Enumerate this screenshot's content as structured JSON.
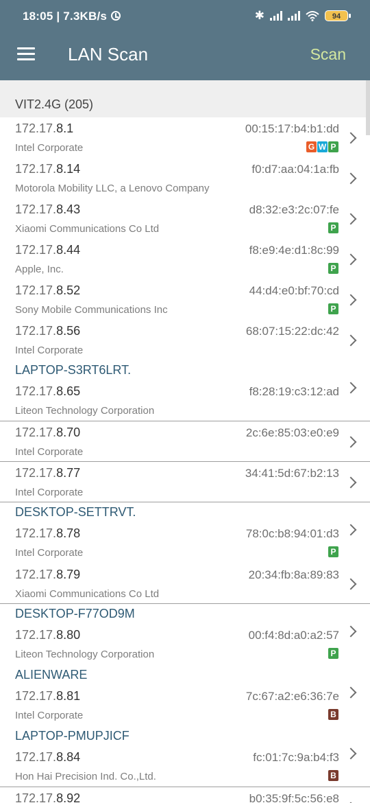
{
  "status_bar": {
    "time_speed": "18:05 | 7.3KB/s",
    "battery": "94"
  },
  "app_bar": {
    "title": "LAN Scan",
    "scan_label": "Scan"
  },
  "network": {
    "name": "VIT2.4G (205)"
  },
  "devices": [
    {
      "ip_prefix": "172.17.",
      "ip_suffix": "8.1",
      "mac": "00:15:17:b4:b1:dd",
      "vendor": "Intel Corporate",
      "badges": [
        "G",
        "W",
        "P"
      ]
    },
    {
      "ip_prefix": "172.17.",
      "ip_suffix": "8.14",
      "mac": "f0:d7:aa:04:1a:fb",
      "vendor": "Motorola Mobility LLC, a Lenovo Company",
      "badges": []
    },
    {
      "ip_prefix": "172.17.",
      "ip_suffix": "8.43",
      "mac": "d8:32:e3:2c:07:fe",
      "vendor": "Xiaomi Communications Co Ltd",
      "badges": [
        "P"
      ]
    },
    {
      "ip_prefix": "172.17.",
      "ip_suffix": "8.44",
      "mac": "f8:e9:4e:d1:8c:99",
      "vendor": "Apple, Inc.",
      "badges": [
        "P"
      ]
    },
    {
      "ip_prefix": "172.17.",
      "ip_suffix": "8.52",
      "mac": "44:d4:e0:bf:70:cd",
      "vendor": "Sony Mobile Communications Inc",
      "badges": [
        "P"
      ]
    },
    {
      "ip_prefix": "172.17.",
      "ip_suffix": "8.56",
      "mac": "68:07:15:22:dc:42",
      "vendor": "Intel Corporate",
      "badges": []
    },
    {
      "hostname": "LAPTOP-S3RT6LRT.",
      "ip_prefix": "172.17.",
      "ip_suffix": "8.65",
      "mac": "f8:28:19:c3:12:ad",
      "vendor": "Liteon Technology Corporation",
      "badges": []
    },
    {
      "ip_prefix": "172.17.",
      "ip_suffix": "8.70",
      "mac": "2c:6e:85:03:e0:e9",
      "vendor": "Intel Corporate",
      "badges": []
    },
    {
      "ip_prefix": "172.17.",
      "ip_suffix": "8.77",
      "mac": "34:41:5d:67:b2:13",
      "vendor": "Intel Corporate",
      "badges": []
    },
    {
      "hostname": "DESKTOP-SETTRVT.",
      "ip_prefix": "172.17.",
      "ip_suffix": "8.78",
      "mac": "78:0c:b8:94:01:d3",
      "vendor": "Intel Corporate",
      "badges": [
        "P"
      ]
    },
    {
      "ip_prefix": "172.17.",
      "ip_suffix": "8.79",
      "mac": "20:34:fb:8a:89:83",
      "vendor": "Xiaomi Communications Co Ltd",
      "badges": []
    },
    {
      "hostname": "DESKTOP-F77OD9M",
      "ip_prefix": "172.17.",
      "ip_suffix": "8.80",
      "mac": "00:f4:8d:a0:a2:57",
      "vendor": "Liteon Technology Corporation",
      "badges": [
        "P"
      ]
    },
    {
      "hostname": "ALIENWARE",
      "ip_prefix": "172.17.",
      "ip_suffix": "8.81",
      "mac": "7c:67:a2:e6:36:7e",
      "vendor": "Intel Corporate",
      "badges": [
        "B"
      ]
    },
    {
      "hostname": "LAPTOP-PMUPJICF",
      "ip_prefix": "172.17.",
      "ip_suffix": "8.84",
      "mac": "fc:01:7c:9a:b4:f3",
      "vendor": "Hon Hai Precision Ind. Co.,Ltd.",
      "badges": [
        "B"
      ]
    },
    {
      "ip_prefix": "172.17.",
      "ip_suffix": "8.92",
      "mac": "b0:35:9f:5c:56:e8",
      "vendor": "",
      "badges": []
    }
  ]
}
